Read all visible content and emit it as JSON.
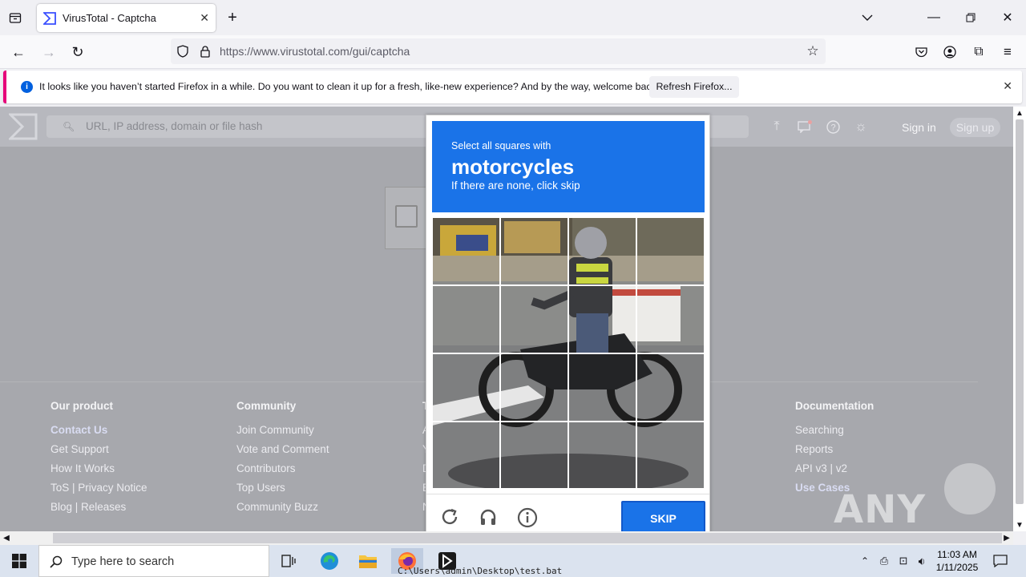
{
  "browser": {
    "tab_title": "VirusTotal - Captcha",
    "url": "https://www.virustotal.com/gui/captcha",
    "notification": {
      "message": "It looks like you haven’t started Firefox in a while. Do you want to clean it up for a fresh, like-new experience? And by the way, welcome back!",
      "button": "Refresh Firefox..."
    }
  },
  "vt": {
    "search_placeholder": "URL, IP address, domain or file hash",
    "sign_in": "Sign in",
    "sign_up": "Sign up"
  },
  "footer": {
    "col1": {
      "heading": "Our product",
      "items": [
        "Contact Us",
        "Get Support",
        "How It Works",
        "ToS | Privacy Notice",
        "Blog | Releases"
      ]
    },
    "col2": {
      "heading": "Community",
      "items": [
        "Join Community",
        "Vote and Comment",
        "Contributors",
        "Top Users",
        "Community Buzz"
      ]
    },
    "col3": {
      "heading": "T",
      "items": [
        "A",
        "Y",
        "D",
        "E",
        "N"
      ]
    },
    "col4": {
      "heading": "Documentation",
      "items": [
        "Searching",
        "Reports",
        "API v3 | v2",
        "Use Cases"
      ]
    }
  },
  "captcha": {
    "instruction": "Select all squares with",
    "target": "motorcycles",
    "hint": "If there are none, click skip",
    "skip": "SKIP"
  },
  "watermark": "ANY RUN",
  "taskbar": {
    "search_text": "Type here to search",
    "time": "11:03 AM",
    "date": "1/11/2025",
    "cmd_fragment": "C:\\Users\\admin\\Desktop\\test.bat"
  },
  "colors": {
    "firefox_accent": "#e6007a",
    "captcha_blue": "#1a73e8"
  }
}
